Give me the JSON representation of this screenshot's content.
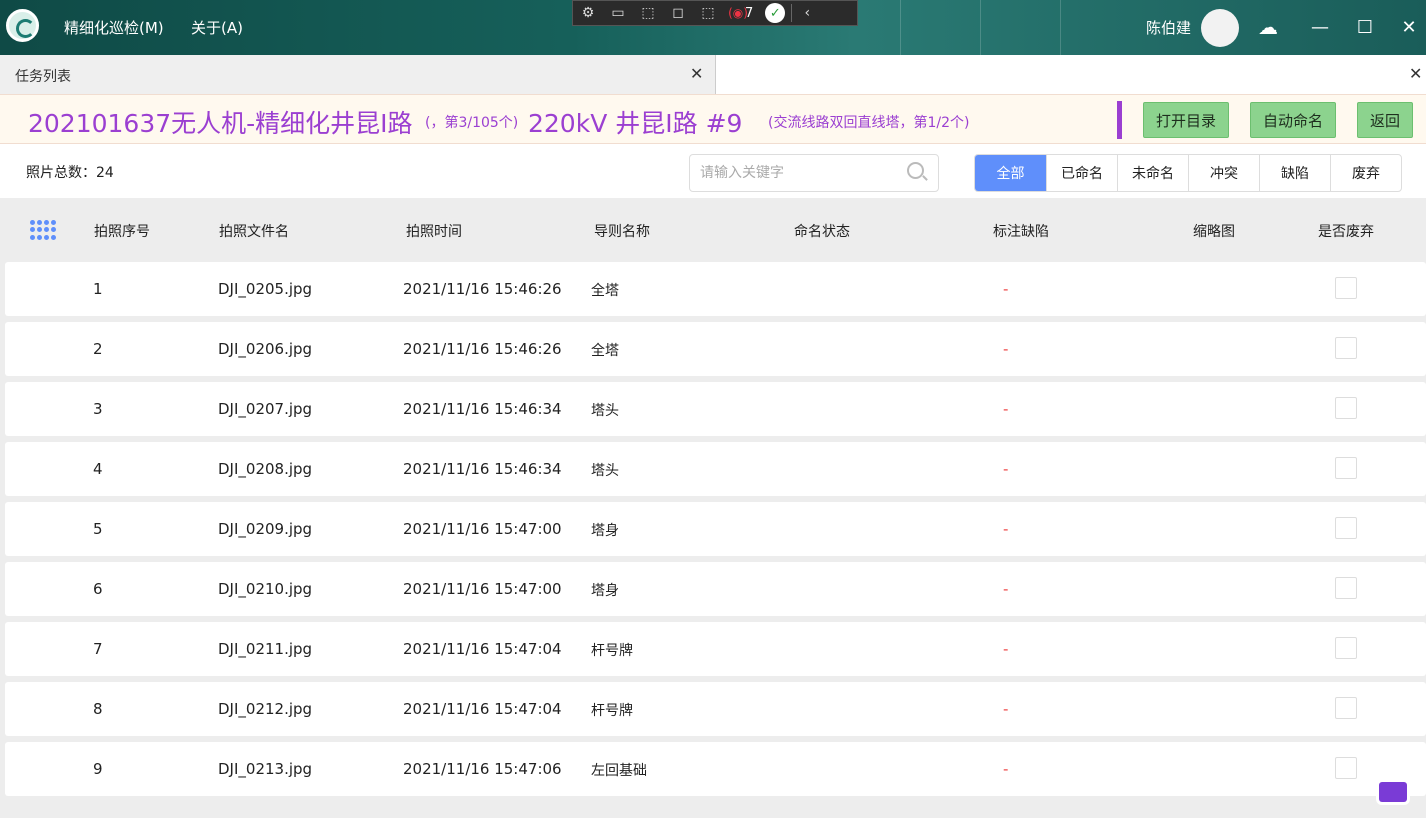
{
  "app": {
    "menus": [
      "精细化巡检(M)",
      "关于(A)"
    ],
    "toolbar_count": "7",
    "user_name": "陈伯建"
  },
  "tabs": [
    {
      "label": "任务列表"
    }
  ],
  "header": {
    "title": "202101637无人机-精细化井昆Ⅰ路",
    "count": "(，第3/105个)",
    "tower": "220kV 井昆Ⅰ路 #9",
    "tower_type": "(交流线路双回直线塔，第1/2个)",
    "buttons": {
      "open_dir": "打开目录",
      "auto_name": "自动命名",
      "back": "返回"
    }
  },
  "filter": {
    "total": "照片总数：24",
    "search_placeholder": "请输入关键字",
    "segments": [
      "全部",
      "已命名",
      "未命名",
      "冲突",
      "缺陷",
      "废弃"
    ],
    "active_segment": "全部"
  },
  "table": {
    "columns": [
      "拍照序号",
      "拍照文件名",
      "拍照时间",
      "导则名称",
      "命名状态",
      "标注缺陷",
      "缩略图",
      "是否废弃"
    ],
    "rows": [
      {
        "no": "1",
        "file": "DJI_0205.jpg",
        "time": "2021/11/16 15:46:26",
        "rule": "全塔",
        "defect": "-"
      },
      {
        "no": "2",
        "file": "DJI_0206.jpg",
        "time": "2021/11/16 15:46:26",
        "rule": "全塔",
        "defect": "-"
      },
      {
        "no": "3",
        "file": "DJI_0207.jpg",
        "time": "2021/11/16 15:46:34",
        "rule": "塔头",
        "defect": "-"
      },
      {
        "no": "4",
        "file": "DJI_0208.jpg",
        "time": "2021/11/16 15:46:34",
        "rule": "塔头",
        "defect": "-"
      },
      {
        "no": "5",
        "file": "DJI_0209.jpg",
        "time": "2021/11/16 15:47:00",
        "rule": "塔身",
        "defect": "-"
      },
      {
        "no": "6",
        "file": "DJI_0210.jpg",
        "time": "2021/11/16 15:47:00",
        "rule": "塔身",
        "defect": "-"
      },
      {
        "no": "7",
        "file": "DJI_0211.jpg",
        "time": "2021/11/16 15:47:04",
        "rule": "杆号牌",
        "defect": "-"
      },
      {
        "no": "8",
        "file": "DJI_0212.jpg",
        "time": "2021/11/16 15:47:04",
        "rule": "杆号牌",
        "defect": "-"
      },
      {
        "no": "9",
        "file": "DJI_0213.jpg",
        "time": "2021/11/16 15:47:06",
        "rule": "左回基础",
        "defect": "-"
      }
    ]
  },
  "colors": {
    "accent_purple": "#9b3fd1",
    "button_green": "#8cd38e",
    "segment_active": "#5f8ffb",
    "defect_red": "#e44"
  }
}
